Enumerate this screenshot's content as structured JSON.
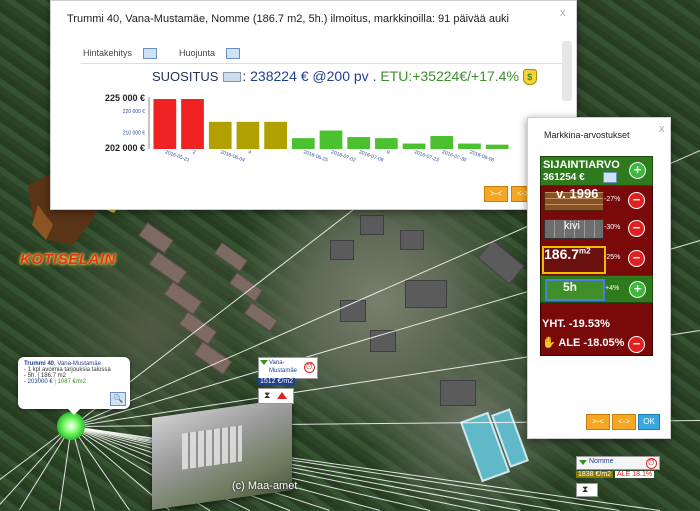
{
  "chart_data": {
    "type": "bar",
    "categories": [
      "2016-05-21",
      "2",
      "2016-06-04",
      "4",
      "",
      "2016-06-25",
      "2016-07-02",
      "2016-07-09",
      "9",
      "2016-07-23",
      "2016-07-30",
      "2016-08-06",
      ""
    ],
    "values": [
      225000,
      225000,
      214500,
      214500,
      214500,
      207000,
      210500,
      207500,
      207000,
      204500,
      208000,
      204500,
      204000
    ],
    "colors": [
      "#ee2222",
      "#ee2222",
      "#b0a000",
      "#b0a000",
      "#b0a000",
      "#4cc12f",
      "#4cc12f",
      "#4cc12f",
      "#4cc12f",
      "#4cc12f",
      "#4cc12f",
      "#4cc12f",
      "#4cc12f"
    ],
    "ylim": [
      202000,
      225000
    ],
    "ytick_major": [
      "225 000 €",
      "202 000 €"
    ],
    "ytick_minor": [
      "220 000 €",
      "210 000 €"
    ],
    "title": "",
    "xlabel": "",
    "ylabel": ""
  },
  "main_dialog": {
    "title": "Trummi 40, Vana-Mustamäe, Nomme (186.7 m2, 5h.) ilmoitus, markkinoilla: 91 päivää auki",
    "close": "x",
    "tabs": [
      "Hintakehitys",
      "Huojunta"
    ],
    "suositus_label": "SUOSITUS",
    "suositus_value": "238224 € @200 pv",
    "etu_value": "ETU:+35224€/+17.4%"
  },
  "nav": {
    "prev": ">-<",
    "next": "<->",
    "ok": "OK"
  },
  "logo": {
    "text": "KOTISELAIN"
  },
  "market": {
    "title": "Markkina-arvostukset",
    "close": "x",
    "sijaintiarvo_label": "SIJAINTIARVO",
    "sijaintiarvo_value": "361254 €",
    "year": "v. 1996",
    "year_pct": "-27%",
    "material": "kivi",
    "material_pct": "-30%",
    "area": "186.7",
    "area_unit": "m2",
    "area_pct": "-25%",
    "rooms": "5h",
    "rooms_pct": "+4%",
    "total": "YHT. -19.53%",
    "discount": "ALE -18.05%"
  },
  "popup": {
    "title_bold": "Trummi 40",
    "title_rest": ", Vana-Mustamäe",
    "line1": "- 1 kpl avoimia tarjouksia talossa",
    "line2": "- 5h. | 186.7 m2",
    "price": "- 203000 €",
    "per_m2": "1087 €/m2"
  },
  "marker1": {
    "name": "Vana-Mustamäe",
    "price": "1512 €/m2"
  },
  "marker2": {
    "name": "Nomme",
    "price": "1838 €/m2",
    "sale": "ALE 18.1%"
  },
  "copyright": "(c) Maa-amet"
}
